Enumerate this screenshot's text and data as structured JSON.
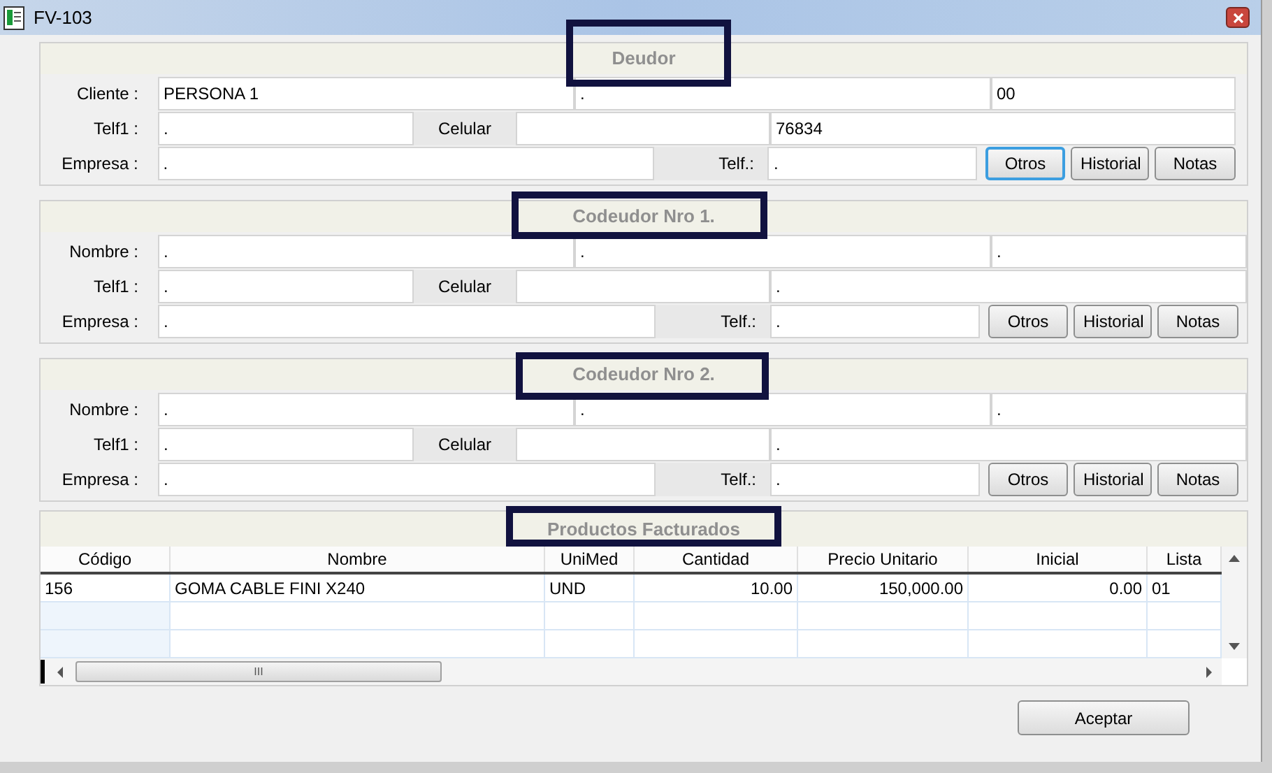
{
  "window": {
    "title": "FV-103"
  },
  "sections": [
    {
      "title": "Deudor",
      "labels": [
        "Cliente :",
        "Telf1 :",
        "Empresa :"
      ],
      "row1": [
        "PERSONA 1",
        ".",
        "00"
      ],
      "row2": {
        "field_1": ".",
        "middle_label": "Celular",
        "field_3": "76834"
      },
      "row3": {
        "field_1": ".",
        "middle_label": "Telf.:",
        "field_2": "."
      },
      "buttons": [
        {
          "label": "Otros",
          "focused": true
        },
        {
          "label": "Historial",
          "focused": false
        },
        {
          "label": "Notas",
          "focused": false
        }
      ]
    },
    {
      "title": "Codeudor Nro 1.",
      "labels": [
        "Nombre :",
        "Telf1 :",
        "Empresa :"
      ],
      "row1": [
        ".",
        ".",
        "."
      ],
      "row2": {
        "field_1": ".",
        "middle_label": "Celular",
        "field_3": "."
      },
      "row3": {
        "field_1": ".",
        "middle_label": "Telf.:",
        "field_2": "."
      },
      "buttons": [
        {
          "label": "Otros",
          "focused": false
        },
        {
          "label": "Historial",
          "focused": false
        },
        {
          "label": "Notas",
          "focused": false
        }
      ]
    },
    {
      "title": "Codeudor Nro 2.",
      "labels": [
        "Nombre :",
        "Telf1 :",
        "Empresa :"
      ],
      "row1": [
        ".",
        ".",
        "."
      ],
      "row2": {
        "field_1": ".",
        "middle_label": "Celular",
        "field_3": "."
      },
      "row3": {
        "field_1": ".",
        "middle_label": "Telf.:",
        "field_2": "."
      },
      "buttons": [
        {
          "label": "Otros",
          "focused": false
        },
        {
          "label": "Historial",
          "focused": false
        },
        {
          "label": "Notas",
          "focused": false
        }
      ]
    }
  ],
  "products": {
    "title": "Productos Facturados",
    "columns": [
      "Código",
      "Nombre",
      "UniMed",
      "Cantidad",
      "Precio Unitario",
      "Inicial",
      "Lista"
    ],
    "rows": [
      [
        "156",
        "GOMA CABLE FINI X240",
        "UND",
        "10.00",
        "150,000.00",
        "0.00",
        "01"
      ]
    ],
    "scroll_thumb": "III"
  },
  "footer_button": "Aceptar"
}
